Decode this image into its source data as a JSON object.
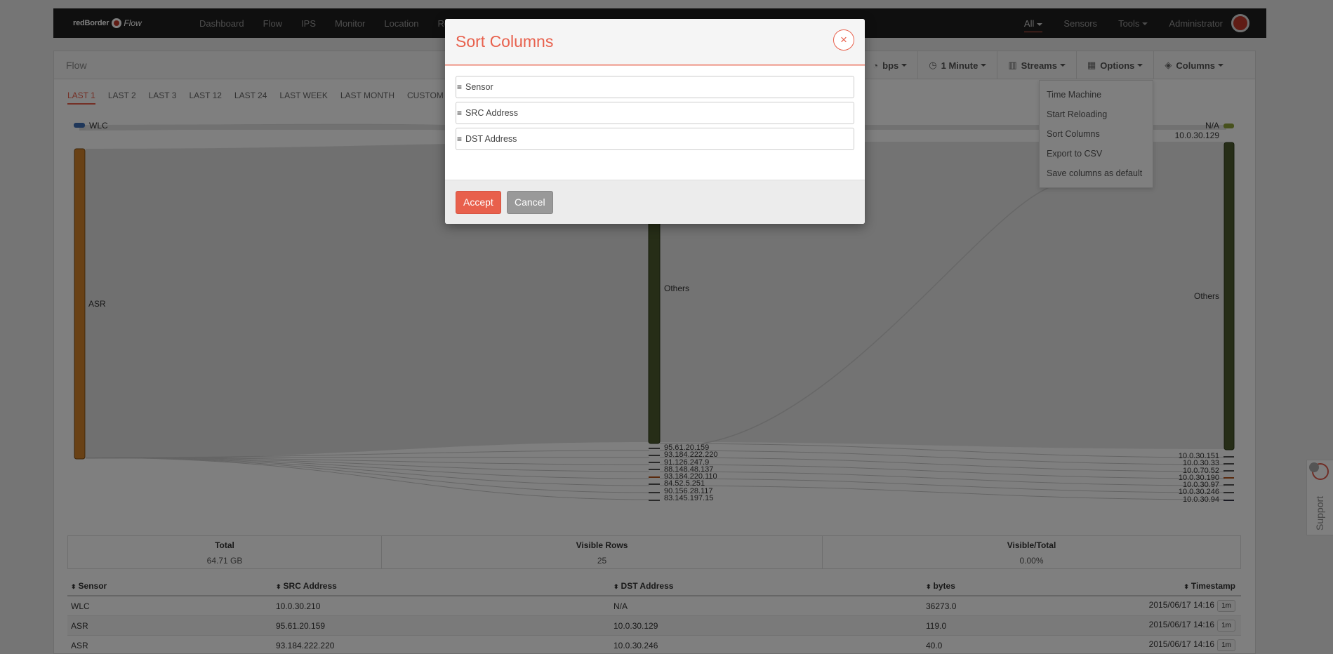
{
  "app": {
    "logo_brand": "redBorder",
    "logo_product": "Flow"
  },
  "nav": {
    "items": [
      "Dashboard",
      "Flow",
      "IPS",
      "Monitor",
      "Location",
      "Report"
    ],
    "right": {
      "all": "All",
      "sensors": "Sensors",
      "tools": "Tools",
      "user": "Administrator"
    }
  },
  "panel": {
    "title": "Flow",
    "toolbar": {
      "unit": "bps",
      "interval": "1 Minute",
      "streams": "Streams",
      "options": "Options",
      "columns": "Columns"
    },
    "ranges": [
      "LAST 1",
      "LAST 2",
      "LAST 3",
      "LAST 12",
      "LAST 24",
      "LAST WEEK",
      "LAST MONTH",
      "CUSTOM"
    ]
  },
  "options_menu": [
    "Time Machine",
    "Start Reloading",
    "Sort Columns",
    "Export to CSV",
    "Save columns as default"
  ],
  "sankey": {
    "left_nodes": [
      "WLC",
      "ASR"
    ],
    "middle_nodes": [
      "Others"
    ],
    "middle_ips": [
      "95.61.20.159",
      "93.184.222.220",
      "91.126.247.9",
      "88.148.48.137",
      "93.184.220.110",
      "84.52.5.251",
      "90.156.28.117",
      "83.145.197.15"
    ],
    "right_top": [
      "N/A",
      "10.0.30.129"
    ],
    "right_nodes": [
      "Others"
    ],
    "right_ips": [
      "10.0.30.151",
      "10.0.30.33",
      "10.0.70.52",
      "10.0.30.190",
      "10.0.30.97",
      "10.0.30.246",
      "10.0.30.94"
    ]
  },
  "stats": {
    "total_label": "Total",
    "total_value": "64.71 GB",
    "visible_label": "Visible Rows",
    "visible_value": "25",
    "ratio_label": "Visible/Total",
    "ratio_value": "0.00%"
  },
  "table": {
    "headers": [
      "Sensor",
      "SRC Address",
      "DST Address",
      "bytes",
      "Timestamp"
    ],
    "rows": [
      [
        "WLC",
        "10.0.30.210",
        "N/A",
        "36273.0",
        "2015/06/17 14:16",
        "1m"
      ],
      [
        "ASR",
        "95.61.20.159",
        "10.0.30.129",
        "119.0",
        "2015/06/17 14:16",
        "1m"
      ],
      [
        "ASR",
        "93.184.222.220",
        "10.0.30.246",
        "40.0",
        "2015/06/17 14:16",
        "1m"
      ]
    ]
  },
  "support": {
    "label": "Support"
  },
  "modal": {
    "title": "Sort Columns",
    "close_glyph": "×",
    "items": [
      "Sensor",
      "SRC Address",
      "DST Address"
    ],
    "accept": "Accept",
    "cancel": "Cancel"
  },
  "colors": {
    "accent": "#e8604c",
    "nav_bg": "#1e1e1e",
    "node_orange": "#d2822a",
    "node_green": "#4d5a2e",
    "wlc_blue": "#3f6fb5"
  }
}
